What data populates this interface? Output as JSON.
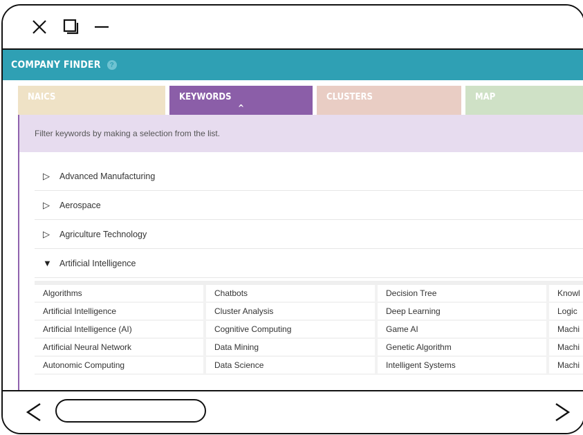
{
  "app": {
    "title": "COMPANY FINDER",
    "help_label": "?"
  },
  "tabs": [
    {
      "label": "NAICS",
      "color": "#efe2c6",
      "active": false
    },
    {
      "label": "KEYWORDS",
      "color": "#8b5ea8",
      "active": true
    },
    {
      "label": "CLUSTERS",
      "color": "#e9cdc4",
      "active": false
    },
    {
      "label": "MAP",
      "color": "#cfe1c6",
      "active": false
    }
  ],
  "active_tab_marker": "^",
  "filter_text": "Filter keywords by making a selection from the list.",
  "categories": [
    {
      "label": "Advanced Manufacturing",
      "expanded": false
    },
    {
      "label": "Aerospace",
      "expanded": false
    },
    {
      "label": "Agriculture Technology",
      "expanded": false
    },
    {
      "label": "Artificial Intelligence",
      "expanded": true
    }
  ],
  "keywords": {
    "columns": [
      [
        "Algorithms",
        "Artificial Intelligence",
        "Artificial Intelligence (AI)",
        "Artificial Neural Network",
        "Autonomic Computing"
      ],
      [
        "Chatbots",
        "Cluster Analysis",
        "Cognitive Computing",
        "Data Mining",
        "Data Science"
      ],
      [
        "Decision Tree",
        "Deep Learning",
        "Game AI",
        "Genetic Algorithm",
        "Intelligent Systems"
      ],
      [
        "Knowl",
        "Logic ",
        "Machi",
        "Machi",
        "Machi"
      ]
    ]
  },
  "colors": {
    "header": "#2fa0b4",
    "accent": "#8b5ea8",
    "filter_banner": "#e7dcef"
  }
}
